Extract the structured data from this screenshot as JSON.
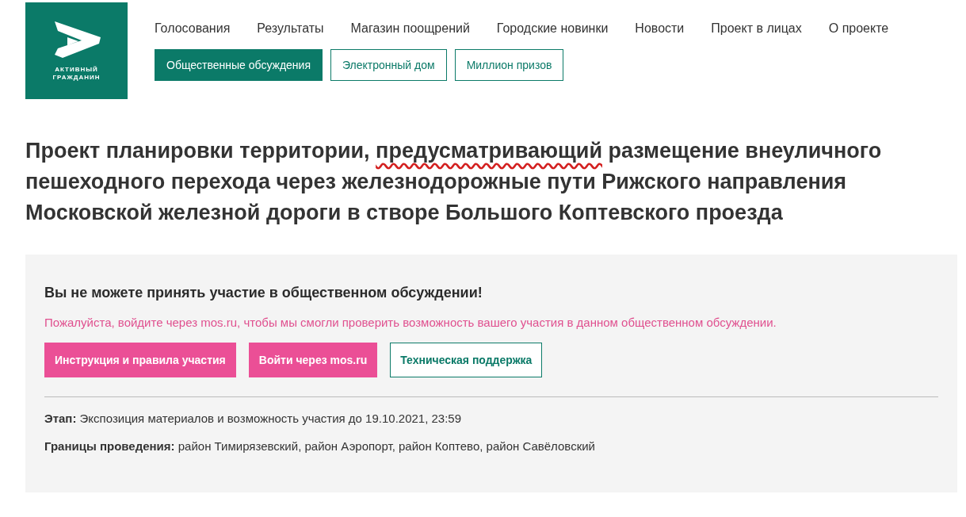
{
  "logo": {
    "text_lines": [
      "АКТИВНЫЙ",
      "ГРАЖДАНИН"
    ]
  },
  "nav": [
    "Голосования",
    "Результаты",
    "Магазин поощрений",
    "Городские новинки",
    "Новости",
    "Проект в лицах",
    "О проекте"
  ],
  "sections": [
    {
      "label": "Общественные обсуждения",
      "selected": true
    },
    {
      "label": "Электронный дом",
      "selected": false
    },
    {
      "label": "Миллион призов",
      "selected": false
    }
  ],
  "title": [
    {
      "text": "Проект планировки территории, ",
      "spelling_error": false
    },
    {
      "text": "предусматривающий",
      "spelling_error": true
    },
    {
      "text": " размещение внеуличного пешеходного перехода через железнодорожные пути Рижского направления Московской железной дороги в створе Большого Коптевского проезда",
      "spelling_error": false
    }
  ],
  "notice": {
    "heading": "Вы не можете принять участие в общественном обсуждении!",
    "message": "Пожалуйста, войдите через mos.ru, чтобы мы смогли проверить возможность вашего участия в данном общественном обсуждении.",
    "buttons": [
      {
        "label": "Инструкция и правила участия",
        "kind": "filled"
      },
      {
        "label": "Войти через mos.ru",
        "kind": "filled"
      },
      {
        "label": "Техническая поддержка",
        "kind": "outline"
      }
    ]
  },
  "details": [
    "**Этап:** Экспозиция материалов и возможность участия до 19.10.2021, 23:59",
    "**Границы проведения:** район Тимирязевский, район Аэропорт, район Коптево, район Савёловский"
  ]
}
